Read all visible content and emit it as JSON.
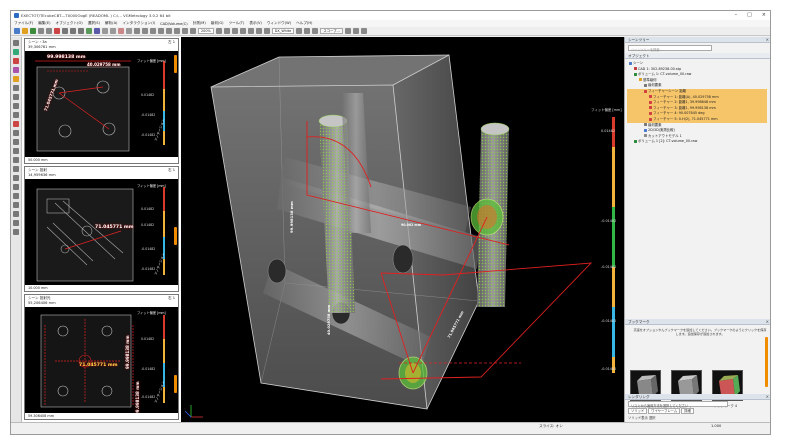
{
  "window": {
    "title": "EXECTOT/TEcubeCBT—TX000OogE (READOML ) C:\\... VGMetrology 3.0.2 64 bit",
    "controls": [
      "–",
      "□",
      "×"
    ]
  },
  "menu": [
    "ファイル(F)",
    "編集(E)",
    "オブジェクト(O)",
    "選択(S)",
    "解析(A)",
    "インタラクション(I)",
    "CAD/Volume(C)",
    "計測(M)",
    "幾何(G)",
    "ツール(T)",
    "表示(V)",
    "ウィンドウ(W)",
    "ヘルプ(H)"
  ],
  "toolbar": {
    "zoom_value": "200%",
    "material_select": "DX_White",
    "view_select": "スコープ…"
  },
  "thumbnails": [
    {
      "header_a": "シーン・3a",
      "header_b": "39,306781 mm",
      "tag": "左 1",
      "footer": "50.000 mm",
      "dist_main": "99.998138 mm",
      "dist_secondary": "40.029758 mm",
      "dist_side": "71.045771 mm",
      "deviation_unit": "フィット偏差 [mm]",
      "ticks": [
        "0.01482",
        "-0.01482",
        "-0.01482"
      ],
      "caption": "アノテーション"
    },
    {
      "header_a": "シーン 投射",
      "header_b": "14,959636 mm",
      "tag": "右 1",
      "footer": "10.000 mm",
      "dist_main": "71.045771 mm",
      "dist_secondary": "",
      "dist_side": "",
      "deviation_unit": "フィット偏差 [mm]",
      "ticks": [
        "0.01482",
        "0.01482",
        "-0.01482",
        "-0.01482"
      ],
      "caption": "アノテーション"
    },
    {
      "header_a": "シーン 投射光",
      "header_b": "55,206406 mm",
      "tag": "右 1",
      "footer": "59.306408 mm",
      "dist_main": "71.045771 mm",
      "dist_secondary": "99.998138 mm",
      "dist_side": "99.998138 mm",
      "deviation_unit": "フィット偏差 [mm]",
      "ticks": [
        "0.01482",
        "-0.01482",
        "-0.01482"
      ],
      "caption": "アノテーション"
    }
  ],
  "viewport": {
    "deviation_unit": "フィット偏差 [mm]",
    "ticks": [
      "0.01482",
      "-0.01482",
      "-0.01482",
      "-0.01482",
      "-0.01482"
    ],
    "dist_long": "99.998138 mm",
    "dist_small": "90.002 mm",
    "dist_angle": "71.045771 mm",
    "dist_vertical": "40.029758 mm"
  },
  "scene_tree": {
    "title": "シーンツリー",
    "search_placeholder": "シーンツリーを検索...",
    "section": "オブジェクト",
    "rows": [
      {
        "label": "シーン",
        "indent": 0,
        "hl": false,
        "color": "#4a7bc8"
      },
      {
        "label": "CAD 1: 302-89238-00.stp",
        "indent": 1,
        "hl": false,
        "color": "#c43a3a"
      },
      {
        "label": "ボリューム 1: CT-volume_00.raw",
        "indent": 1,
        "hl": false,
        "color": "#2d8a3a"
      },
      {
        "label": "基準幾何",
        "indent": 2,
        "hl": false,
        "color": "#e0a020"
      },
      {
        "label": "幾何要素",
        "indent": 3,
        "hl": false,
        "color": "#777777"
      },
      {
        "label": "フィーチャーシーン 距離",
        "indent": 3,
        "hl": true,
        "color": "#d04040"
      },
      {
        "label": "フィーチャー 1: 距離(A), 40.029758 mm",
        "indent": 4,
        "hl": true,
        "color": "#d04040"
      },
      {
        "label": "フィーチャー 2: 距離1, 39.998648 mm",
        "indent": 4,
        "hl": true,
        "color": "#d04040"
      },
      {
        "label": "フィーチャー 3: 距離1, 99.998138 mm",
        "indent": 4,
        "hl": true,
        "color": "#d04040"
      },
      {
        "label": "フィーチャー 4: 90.007845 deg",
        "indent": 4,
        "hl": true,
        "color": "#d04040"
      },
      {
        "label": "フィーチャー 5: 0-H(2), 71.045771 mm",
        "indent": 4,
        "hl": true,
        "color": "#d04040"
      },
      {
        "label": "幾何要素",
        "indent": 3,
        "hl": false,
        "color": "#777777"
      },
      {
        "label": "2D/3D(実測比較)",
        "indent": 3,
        "hl": false,
        "color": "#4a7bc8"
      },
      {
        "label": "カットアウトモデル 1",
        "indent": 3,
        "hl": false,
        "color": "#8a8a8a"
      },
      {
        "label": "ボリューム 1 [2]: CT-volume_00.raw",
        "indent": 1,
        "hl": false,
        "color": "#2d8a3a"
      }
    ]
  },
  "bookmarks": {
    "title": "ブックマーク",
    "hint": "高速をオプションやんブックマークを追加してください。ブックマークのようにクリックを保存します。追加保存が追加されます。",
    "items": [
      "ブックマーク 2",
      "ブックマーク 3",
      "ブックマーク 4"
    ]
  },
  "rendering": {
    "title": "レンダリング",
    "hint": "リストから適用方法を選択してください",
    "tabs": [
      "ソリッド",
      "ワイヤーフレーム",
      "詳細"
    ],
    "props": [
      "ソリッド表示 選択",
      "レンダリングの領域"
    ]
  },
  "statusbar": {
    "left": "",
    "mid": "スライス: オン",
    "right": "1.000"
  }
}
